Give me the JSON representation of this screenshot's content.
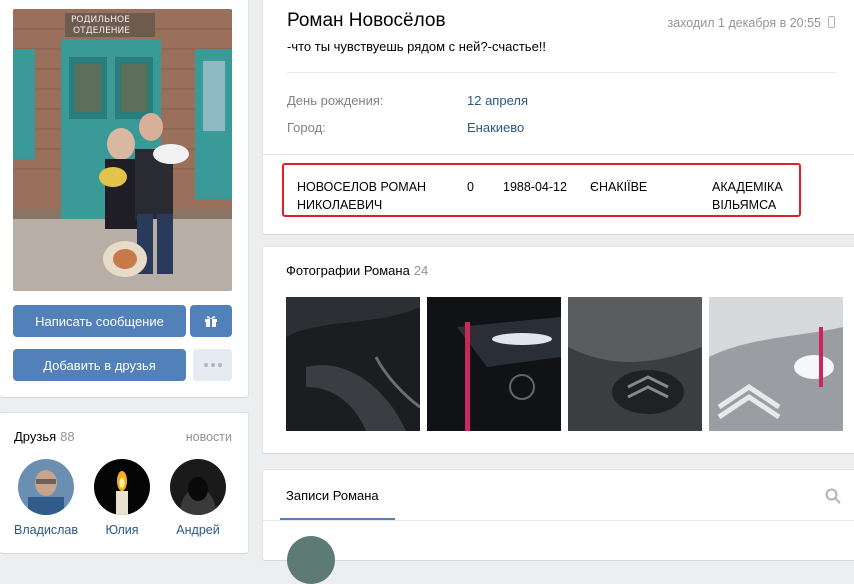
{
  "profile": {
    "name": "Роман Новосёлов",
    "last_seen": "заходил 1 декабря в 20:55",
    "status": "-что ты чувствуешь рядом с ней?-счастье!!",
    "info": [
      {
        "label": "День рождения:",
        "value": "12 апреля"
      },
      {
        "label": "Город:",
        "value": "Енакиево"
      }
    ]
  },
  "highlight_record": {
    "name": "НОВОСЕЛОВ РОМАН НИКОЛАЕВИЧ",
    "number": "0",
    "date": "1988-04-12",
    "city": "ЄНАКІЇВЕ",
    "street": "АКАДЕМІКА ВІЛЬЯМСА"
  },
  "actions": {
    "message": "Написать сообщение",
    "add_friend": "Добавить в друзья"
  },
  "friends": {
    "title": "Друзья",
    "count": "88",
    "news_link": "новости",
    "items": [
      {
        "name": "Владислав"
      },
      {
        "name": "Юлия"
      },
      {
        "name": "Андрей"
      }
    ]
  },
  "photos": {
    "title": "Фотографии Романа",
    "count": "24"
  },
  "wall": {
    "tab": "Записи Романа"
  },
  "colors": {
    "accent": "#5181b8",
    "link": "#2a5885",
    "highlight_border": "#e0202a",
    "background": "#edeef0"
  },
  "icons": [
    "gift-icon",
    "more-icon",
    "phone-icon",
    "search-icon"
  ]
}
